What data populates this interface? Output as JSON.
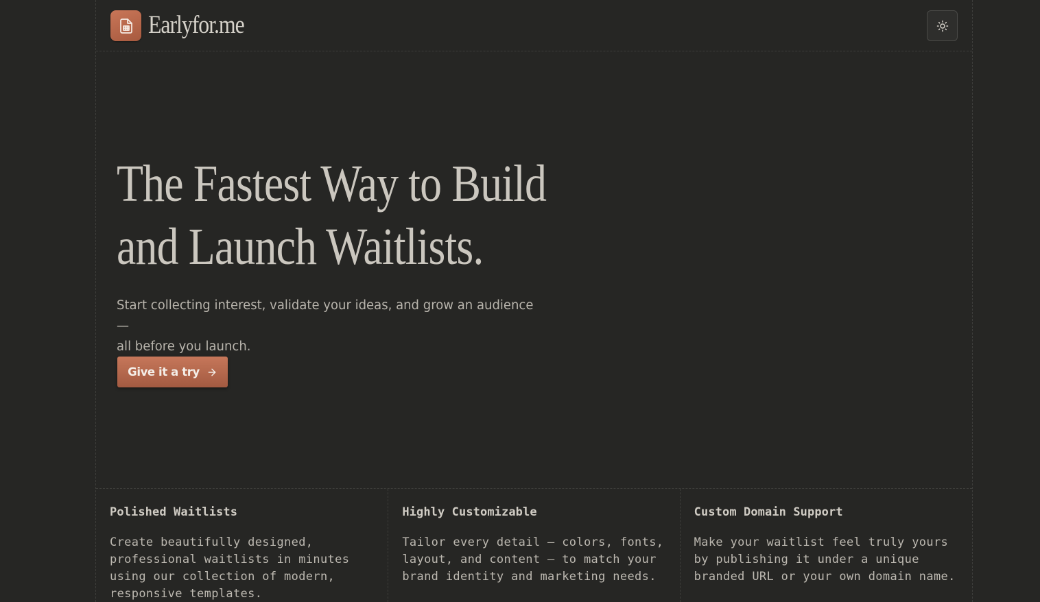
{
  "header": {
    "brand_name": "Earlyfor.me",
    "logo_icon": "spreadsheet-icon",
    "theme_toggle_icon": "sun-icon"
  },
  "hero": {
    "title_line_1": "The Fastest Way to Build",
    "title_line_2": "and Launch Waitlists.",
    "subtitle_line_1": "Start collecting interest, validate your ideas, and grow an audience —",
    "subtitle_line_2": "all before you launch.",
    "cta_label": "Give it a try",
    "cta_icon": "arrow-right-icon"
  },
  "features": [
    {
      "title": "Polished Waitlists",
      "lines": [
        "Create beautifully designed,",
        "professional waitlists in minutes",
        "using our collection of modern,",
        "responsive templates."
      ]
    },
    {
      "title": "Highly Customizable",
      "lines": [
        "Tailor every detail — colors, fonts,",
        "layout, and content — to match your",
        "brand identity and marketing needs."
      ]
    },
    {
      "title": "Custom Domain Support",
      "lines": [
        "Make your waitlist feel truly yours",
        "by publishing it under a unique",
        "branded URL or your own domain name."
      ]
    }
  ],
  "colors": {
    "background": "#262624",
    "accent": "#b8674b",
    "text": "#cbc7bf"
  }
}
